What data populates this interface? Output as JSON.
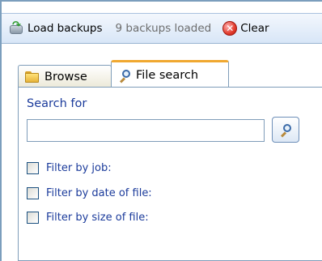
{
  "toolbar": {
    "load_label": "Load backups",
    "status": "9 backups loaded",
    "clear_label": "Clear"
  },
  "tabs": {
    "browse_label": "Browse",
    "file_search_label": "File search",
    "selected": "File search"
  },
  "search": {
    "heading": "Search for",
    "value": ""
  },
  "filters": [
    {
      "label": "Filter by job:",
      "checked": false
    },
    {
      "label": "Filter by date of file:",
      "checked": false
    },
    {
      "label": "Filter by size of file:",
      "checked": false
    }
  ],
  "colors": {
    "accent_tab": "#f0a830",
    "label_blue": "#1b3b9b",
    "border_blue": "#7f9db9"
  }
}
